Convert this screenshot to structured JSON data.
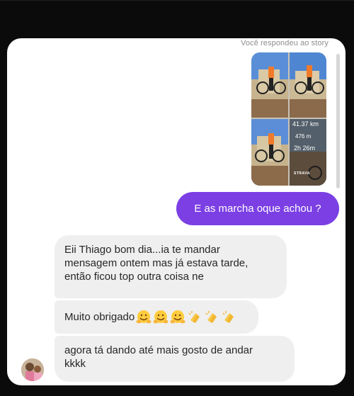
{
  "story_reply": {
    "note": "Você respondeu ao story",
    "stats": {
      "distance": "41.37 km",
      "elevation": "476 m",
      "time": "2h 26m",
      "brand": "STRAVA"
    }
  },
  "messages": [
    {
      "id": "out1",
      "direction": "outgoing",
      "text": "E as marcha oque achou ?"
    },
    {
      "id": "in1",
      "direction": "incoming",
      "text": "Eii Thiago bom dia...ia te mandar\nmensagem ontem mas já estava tarde,\nentão ficou top outra coisa ne"
    },
    {
      "id": "in2",
      "direction": "incoming",
      "text": "Muito obrigado",
      "emojis": [
        "hugging-face",
        "hugging-face",
        "hugging-face",
        "clapping-hands",
        "clapping-hands",
        "clapping-hands"
      ]
    },
    {
      "id": "in3",
      "direction": "incoming",
      "text": "agora tá dando até mais gosto de andar\nkkkk"
    }
  ],
  "colors": {
    "outgoing_bubble": "#7b3fe4",
    "incoming_bubble": "#efefef",
    "background": "#0b0b0b"
  }
}
